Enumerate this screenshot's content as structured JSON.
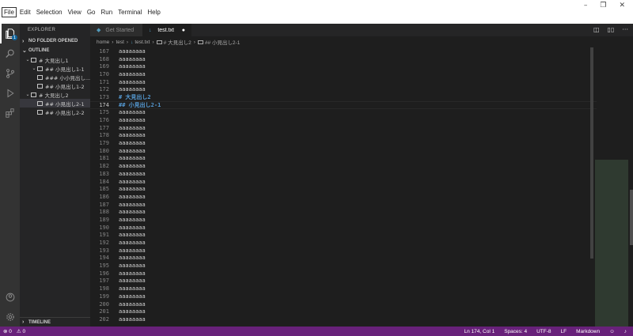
{
  "menu": [
    "File",
    "Edit",
    "Selection",
    "View",
    "Go",
    "Run",
    "Terminal",
    "Help"
  ],
  "window_controls": [
    "–",
    "❐",
    "✕"
  ],
  "activity": {
    "badge": "1",
    "icons": [
      "files-icon",
      "search-icon",
      "source-control-icon",
      "run-debug-icon",
      "extensions-icon"
    ],
    "bottom_icons": [
      "account-icon",
      "settings-gear-icon"
    ]
  },
  "sidebar": {
    "header": "EXPLORER",
    "no_folder": "NO FOLDER OPENED",
    "outline_title": "OUTLINE",
    "outline": [
      {
        "label": "# 大見出し1",
        "indent": 0,
        "chev": "⌄",
        "selected": false
      },
      {
        "label": "## 小見出し1-1",
        "indent": 1,
        "chev": "⌄",
        "selected": false
      },
      {
        "label": "### 小小見出し...",
        "indent": 2,
        "chev": "",
        "selected": false
      },
      {
        "label": "## 小見出し1-2",
        "indent": 1,
        "chev": "",
        "selected": false
      },
      {
        "label": "# 大見出し2",
        "indent": 0,
        "chev": "⌄",
        "selected": false
      },
      {
        "label": "## 小見出し2-1",
        "indent": 1,
        "chev": "",
        "selected": true
      },
      {
        "label": "## 小見出し2-2",
        "indent": 1,
        "chev": "",
        "selected": false
      }
    ],
    "timeline": "TIMELINE"
  },
  "tabs": [
    {
      "label": "Get Started",
      "active": false
    },
    {
      "label": "test.txt",
      "active": true,
      "dirty": "●"
    }
  ],
  "breadcrumb": [
    "home",
    "test",
    "test.txt",
    "# 大見出し2",
    "## 小見出し2-1"
  ],
  "editor": {
    "current_line": 174,
    "lines": [
      {
        "n": "167",
        "t": "aaaaaaaa"
      },
      {
        "n": "168",
        "t": "aaaaaaaa"
      },
      {
        "n": "169",
        "t": "aaaaaaaa"
      },
      {
        "n": "170",
        "t": "aaaaaaaa"
      },
      {
        "n": "171",
        "t": "aaaaaaaa"
      },
      {
        "n": "172",
        "t": "aaaaaaaa"
      },
      {
        "n": "173",
        "t": "# 大見出し2",
        "heading": true
      },
      {
        "n": "174",
        "t": "## 小見出し2-1",
        "heading": true
      },
      {
        "n": "175",
        "t": "aaaaaaaa"
      },
      {
        "n": "176",
        "t": "aaaaaaaa"
      },
      {
        "n": "177",
        "t": "aaaaaaaa"
      },
      {
        "n": "178",
        "t": "aaaaaaaa"
      },
      {
        "n": "179",
        "t": "aaaaaaaa"
      },
      {
        "n": "180",
        "t": "aaaaaaaa"
      },
      {
        "n": "181",
        "t": "aaaaaaaa"
      },
      {
        "n": "182",
        "t": "aaaaaaaa"
      },
      {
        "n": "183",
        "t": "aaaaaaaa"
      },
      {
        "n": "184",
        "t": "aaaaaaaa"
      },
      {
        "n": "185",
        "t": "aaaaaaaa"
      },
      {
        "n": "186",
        "t": "aaaaaaaa"
      },
      {
        "n": "187",
        "t": "aaaaaaaa"
      },
      {
        "n": "188",
        "t": "aaaaaaaa"
      },
      {
        "n": "189",
        "t": "aaaaaaaa"
      },
      {
        "n": "190",
        "t": "aaaaaaaa"
      },
      {
        "n": "191",
        "t": "aaaaaaaa"
      },
      {
        "n": "192",
        "t": "aaaaaaaa"
      },
      {
        "n": "193",
        "t": "aaaaaaaa"
      },
      {
        "n": "194",
        "t": "aaaaaaaa"
      },
      {
        "n": "195",
        "t": "aaaaaaaa"
      },
      {
        "n": "196",
        "t": "aaaaaaaa"
      },
      {
        "n": "197",
        "t": "aaaaaaaa"
      },
      {
        "n": "198",
        "t": "aaaaaaaa"
      },
      {
        "n": "199",
        "t": "aaaaaaaa"
      },
      {
        "n": "200",
        "t": "aaaaaaaa"
      },
      {
        "n": "201",
        "t": "aaaaaaaa"
      },
      {
        "n": "202",
        "t": "aaaaaaaa"
      }
    ]
  },
  "status": {
    "errors": "⊗ 0",
    "warnings": "⚠ 0",
    "position": "Ln 174, Col 1",
    "spaces": "Spaces: 4",
    "encoding": "UTF-8",
    "eol": "LF",
    "language": "Markdown"
  },
  "colors": {
    "statusbar": "#68217a",
    "heading": "#569cd6"
  }
}
